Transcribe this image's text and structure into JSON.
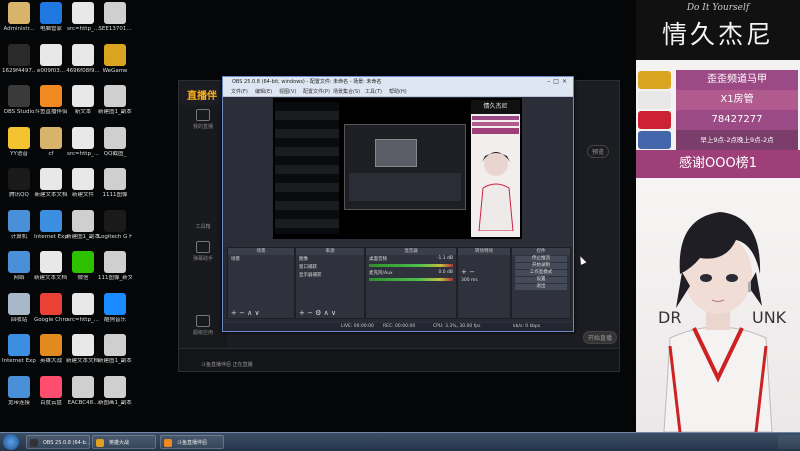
{
  "desktop_icons": [
    {
      "label": "Administr...",
      "color": "#d8b36a"
    },
    {
      "label": "电脑管家",
      "color": "#1e78e0"
    },
    {
      "label": "src=http_...",
      "color": "#e8e8e8"
    },
    {
      "label": "SEE13701...",
      "color": "#cfcfcf"
    },
    {
      "label": "1629f4497...",
      "color": "#2a2a2a"
    },
    {
      "label": "e009f03...",
      "color": "#e8e8e8"
    },
    {
      "label": "4696f08f9...",
      "color": "#e8e8e8"
    },
    {
      "label": "WeGame",
      "color": "#d9a520"
    },
    {
      "label": "OBS Studio",
      "color": "#3a3a3a"
    },
    {
      "label": "斗鱼直播伴侣",
      "color": "#f08a20"
    },
    {
      "label": "新文本",
      "color": "#e8e8e8"
    },
    {
      "label": "新建图1_副本 3333_副本",
      "color": "#cfcfcf"
    },
    {
      "label": "YY语音",
      "color": "#f4c430"
    },
    {
      "label": "cf",
      "color": "#d8b36a"
    },
    {
      "label": "src=http_...",
      "color": "#e8e8e8"
    },
    {
      "label": "QQ截图_",
      "color": "#cfcfcf"
    },
    {
      "label": "腾讯QQ",
      "color": "#1a1a1a"
    },
    {
      "label": "新建文本文档",
      "color": "#e8e8e8"
    },
    {
      "label": "新建文件",
      "color": "#e8e8e8"
    },
    {
      "label": "1111图像",
      "color": "#cfcfcf"
    },
    {
      "label": "计算机",
      "color": "#4a90d9"
    },
    {
      "label": "Internet Explorer",
      "color": "#3c8ee0"
    },
    {
      "label": "新建图1_副本",
      "color": "#cfcfcf"
    },
    {
      "label": "Logitech G HUB",
      "color": "#1a1a1a"
    },
    {
      "label": "网络",
      "color": "#4a90d9"
    },
    {
      "label": "新建文本文档 (2)",
      "color": "#e8e8e8"
    },
    {
      "label": "微信",
      "color": "#2dc100"
    },
    {
      "label": "111图像_新文本2222_...",
      "color": "#cfcfcf"
    },
    {
      "label": "回收站",
      "color": "#a8b8c8"
    },
    {
      "label": "Google Chrome",
      "color": "#e94235"
    },
    {
      "label": "src=http_...",
      "color": "#e8e8e8"
    },
    {
      "label": "酷狗音乐",
      "color": "#1a8cff"
    },
    {
      "label": "Internet Explorer",
      "color": "#3c8ee0"
    },
    {
      "label": "英雄大战",
      "color": "#e08a20"
    },
    {
      "label": "新建文本文档 (3)",
      "color": "#e8e8e8"
    },
    {
      "label": "新建图1_副本_副本",
      "color": "#cfcfcf"
    },
    {
      "label": "宽带连接",
      "color": "#4a90d9"
    },
    {
      "label": "百度云盘",
      "color": "#ff4d6d"
    },
    {
      "label": "EACBC48...",
      "color": "#cfcfcf"
    },
    {
      "label": "新图画1_副本_副本_副本",
      "color": "#cfcfcf"
    }
  ],
  "app": {
    "logo": "直播伴",
    "side_items": [
      "我的直播",
      "工具箱",
      "弹幕助手",
      "超级应用"
    ],
    "right_btn": "预览",
    "bottom_label": "斗鱼直播伴侣 正在直播",
    "start_btn": "开始直播"
  },
  "obs": {
    "title": "OBS 25.0.8 (64-bit, windows) - 配置文件: 未命名 - 场景: 未命名",
    "menu": [
      "文件(F)",
      "编辑(E)",
      "视图(V)",
      "配置文件(P)",
      "场景集合(S)",
      "工具(T)",
      "帮助(H)"
    ],
    "dock_headers": {
      "scenes": "场景",
      "sources": "来源",
      "mixer": "混音器",
      "transitions": "转场特效",
      "controls": "控件"
    },
    "scene_item": "场景",
    "sources": [
      "图像",
      "窗口捕获",
      "显示器捕获"
    ],
    "mixer_tracks": [
      {
        "name": "桌面音频",
        "level": "-1.1 dB"
      },
      {
        "name": "麦克风/Aux",
        "level": "0.0 dB"
      }
    ],
    "transition_duration": "300 ms",
    "controls": [
      "停止推流",
      "开始录制",
      "工作室模式",
      "设置",
      "退出"
    ],
    "status": {
      "live": "LIVE: 00:00:00",
      "rec": "REC: 00:00:00",
      "cpu": "CPU: 3.3%, 30.00 fps",
      "kbps": "kb/s: 0 kbps"
    },
    "nested_title": "情久杰尼"
  },
  "right_panel": {
    "subtitle": "Do It Yourself",
    "title": "情久杰尼",
    "ranks": [
      {
        "text": "歪歪频道马甲",
        "bg": "#9c4a86"
      },
      {
        "text": "X1房管",
        "bg": "#b05a8e"
      },
      {
        "text": "78427277",
        "bg": "#9c4a86"
      },
      {
        "text": "早上9点-2点晚上9点-2点",
        "bg": "#7a3d6c"
      }
    ],
    "thanks": "感谢OOO榜1",
    "avatar_left_text": "DR",
    "avatar_right_text": "UNK"
  },
  "taskbar": {
    "items": [
      {
        "label": "OBS 25.0.8 (64-b...",
        "color": "#333"
      },
      {
        "label": "英雄大战",
        "color": "#e0a020"
      },
      {
        "label": "斗鱼直播伴侣",
        "color": "#f08a20"
      }
    ]
  }
}
